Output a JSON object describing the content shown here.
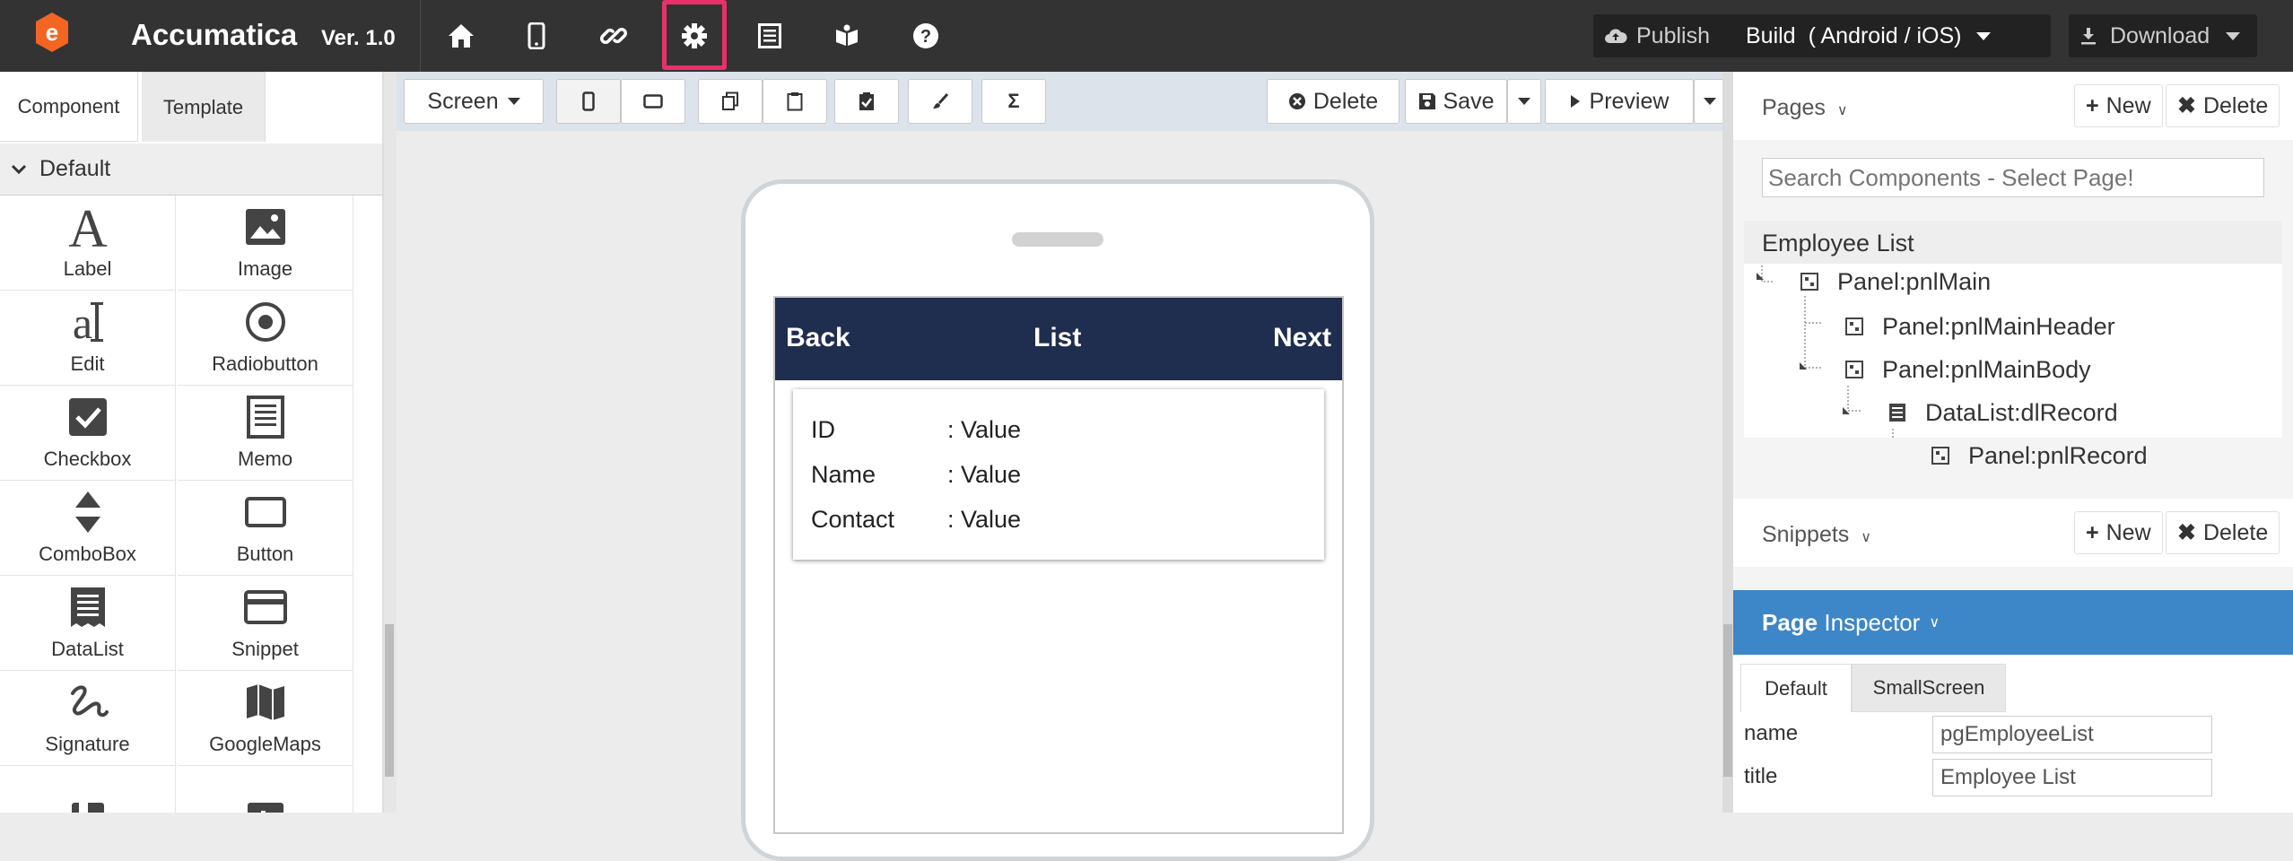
{
  "app": {
    "name": "Accumatica",
    "version": "Ver. 1.0",
    "logo_letter": "e",
    "brand_color": "#f26522"
  },
  "topnav": {
    "icons": [
      "home-icon",
      "mobile-icon",
      "link-icon",
      "gear-icon",
      "list-icon",
      "book-icon",
      "help-icon"
    ],
    "highlighted": "gear-icon",
    "highlight_color": "#e8316a",
    "publish_label": "Publish",
    "build_label": "Build",
    "build_platform": "( Android /  iOS)",
    "download_label": "Download"
  },
  "left_panel": {
    "tabs": [
      "Component",
      "Template"
    ],
    "active_tab": "Component",
    "group": "Default",
    "components": [
      "Label",
      "Image",
      "Edit",
      "Radiobutton",
      "Checkbox",
      "Memo",
      "ComboBox",
      "Button",
      "DataList",
      "Snippet",
      "Signature",
      "GoogleMaps",
      "",
      ""
    ]
  },
  "toolbar": {
    "screen_label": "Screen",
    "delete_label": "Delete",
    "save_label": "Save",
    "preview_label": "Preview",
    "sigma": "Σ"
  },
  "phone": {
    "header": {
      "back": "Back",
      "title": "List",
      "next": "Next"
    },
    "header_color": "#1f2d4e",
    "rows": [
      {
        "label": "ID",
        "value": ": Value"
      },
      {
        "label": "Name",
        "value": ": Value"
      },
      {
        "label": "Contact",
        "value": ": Value"
      }
    ]
  },
  "right_panel": {
    "pages_label": "Pages",
    "new_label": "New",
    "delete_label": "Delete",
    "search_placeholder": "Search Components - Select Page!",
    "tree_root": "Employee List",
    "tree": [
      {
        "label": "Panel:pnlMain",
        "depth": 1
      },
      {
        "label": "Panel:pnlMainHeader",
        "depth": 2
      },
      {
        "label": "Panel:pnlMainBody",
        "depth": 2
      },
      {
        "label": "DataList:dlRecord",
        "depth": 3
      },
      {
        "label": "Panel:pnlRecord",
        "depth": 4
      }
    ],
    "snippets_label": "Snippets",
    "inspector": {
      "title_bold": "Page",
      "title_rest": " Inspector",
      "tabs": [
        "Default",
        "SmallScreen"
      ],
      "active_tab": "Default",
      "props": [
        {
          "name": "name",
          "value": "pgEmployeeList"
        },
        {
          "name": "title",
          "value": "Employee List"
        }
      ],
      "header_color": "#3d86c8"
    }
  }
}
